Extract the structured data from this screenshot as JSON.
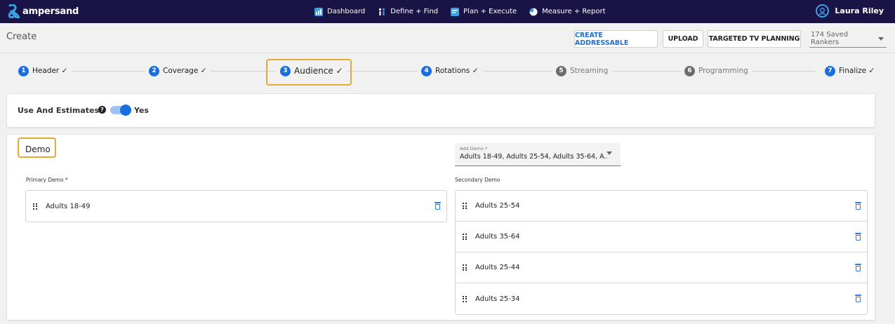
{
  "brand": {
    "name": "ampersand",
    "accent": "#1a6fe0",
    "highlight": "#e6a932"
  },
  "nav": [
    {
      "label": "Dashboard",
      "icon": "dashboard-icon",
      "color": "#3ba0e6"
    },
    {
      "label": "Define + Find",
      "icon": "people-icon",
      "color": "#3ba0e6"
    },
    {
      "label": "Plan + Execute",
      "icon": "calendar-icon",
      "color": "#3ba0e6"
    },
    {
      "label": "Measure + Report",
      "icon": "pie-chart-icon",
      "color": "#ffffff"
    }
  ],
  "user": {
    "name": "Laura Riley",
    "icon": "user-circle-icon"
  },
  "page": {
    "title": "Create"
  },
  "actions": {
    "create_addressable": "CREATE ADDRESSABLE",
    "upload": "UPLOAD",
    "targeted_tv_planning": "TARGETED TV PLANNING",
    "saved_rankers": "174 Saved Rankers"
  },
  "steps": [
    {
      "num": "1",
      "label": "Header ✓",
      "state": "complete"
    },
    {
      "num": "2",
      "label": "Coverage ✓",
      "state": "complete"
    },
    {
      "num": "3",
      "label": "Audience ✓",
      "state": "current"
    },
    {
      "num": "4",
      "label": "Rotations ✓",
      "state": "complete"
    },
    {
      "num": "5",
      "label": "Streaming",
      "state": "disabled"
    },
    {
      "num": "6",
      "label": "Programming",
      "state": "disabled"
    },
    {
      "num": "7",
      "label": "Finalize ✓",
      "state": "complete"
    }
  ],
  "estimates": {
    "label": "Use And Estimates",
    "help_icon": "?",
    "toggle_on": true,
    "toggle_label": "Yes"
  },
  "demo": {
    "title": "Demo",
    "add_demo": {
      "label": "Add Demo *",
      "value": "Adults 18-49, Adults 25-54, Adults 35-64, A..."
    },
    "primary_label": "Primary Demo *",
    "primary": [
      "Adults 18-49"
    ],
    "secondary_label": "Secondary Demo",
    "secondary": [
      "Adults 25-54",
      "Adults 35-64",
      "Adults 25-44",
      "Adults 25-34"
    ]
  }
}
